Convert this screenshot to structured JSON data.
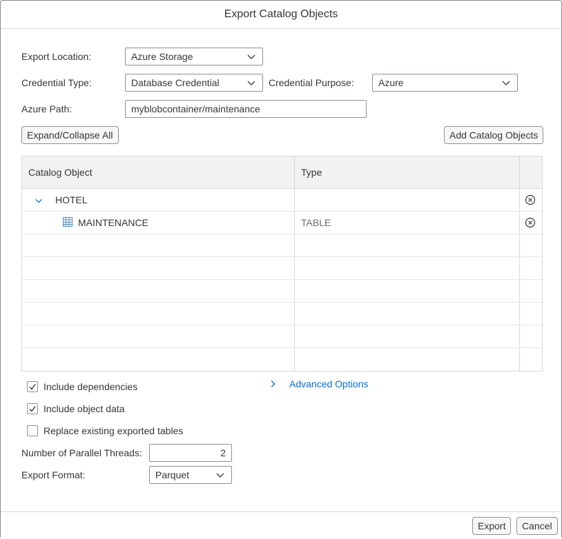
{
  "dialog": {
    "title": "Export Catalog Objects"
  },
  "form": {
    "export_location_label": "Export Location:",
    "export_location_value": "Azure Storage",
    "credential_type_label": "Credential Type:",
    "credential_type_value": "Database Credential",
    "credential_purpose_label": "Credential Purpose:",
    "credential_purpose_value": "Azure",
    "azure_path_label": "Azure Path:",
    "azure_path_value": "myblobcontainer/maintenance"
  },
  "toolbar": {
    "expand_collapse_label": "Expand/Collapse All",
    "add_objects_label": "Add Catalog Objects"
  },
  "table": {
    "columns": [
      "Catalog Object",
      "Type"
    ],
    "rows": [
      {
        "name": "HOTEL",
        "type": "",
        "kind": "schema",
        "expanded": true
      },
      {
        "name": "MAINTENANCE",
        "type": "TABLE",
        "kind": "table"
      }
    ]
  },
  "options": {
    "include_dependencies_label": "Include dependencies",
    "include_dependencies_checked": true,
    "include_object_data_label": "Include object data",
    "include_object_data_checked": true,
    "replace_existing_label": "Replace existing exported tables",
    "replace_existing_checked": false,
    "advanced_options_label": "Advanced Options",
    "threads_label": "Number of Parallel Threads:",
    "threads_value": "2",
    "format_label": "Export Format:",
    "format_value": "Parquet"
  },
  "footer": {
    "export_label": "Export",
    "cancel_label": "Cancel"
  },
  "colors": {
    "border": "#89919a",
    "header_bg": "#f2f2f2",
    "text": "#32363a",
    "accent": "#0a6ed1",
    "secondary_text": "#6a6d70"
  },
  "icons": [
    "chevron-down-icon",
    "chevron-right-icon",
    "table-icon",
    "remove-circle-icon",
    "checkmark-icon"
  ]
}
